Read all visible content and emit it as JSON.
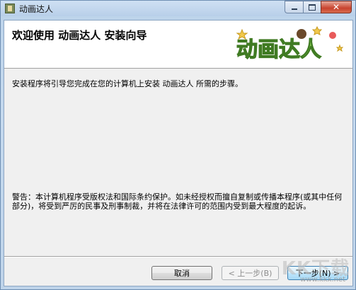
{
  "window": {
    "title": "动画达人",
    "controls": {
      "minimize": "minimize",
      "maximize": "maximize",
      "close": "✕"
    }
  },
  "banner": {
    "title": "欢迎使用  动画达人  安装向导",
    "logo_text": "动画达人"
  },
  "intro": "安装程序将引导您完成在您的计算机上安装  动画达人  所需的步骤。",
  "warning": "警告：本计算机程序受版权法和国际条约保护。如未经授权而擅自复制或传播本程序(或其中任何部分)，将受到严厉的民事及刑事制裁，并将在法律许可的范围内受到最大程度的起诉。",
  "buttons": {
    "cancel": "取消",
    "back": "< 上一步(B)",
    "next": "下一步(N) >"
  },
  "watermark": {
    "brand": "KK下载",
    "url": "www.kkx.net"
  },
  "colors": {
    "banner_bg": "#ffffff",
    "dialog_bg": "#f0f0f0",
    "next_accent": "#3c7fb1"
  }
}
